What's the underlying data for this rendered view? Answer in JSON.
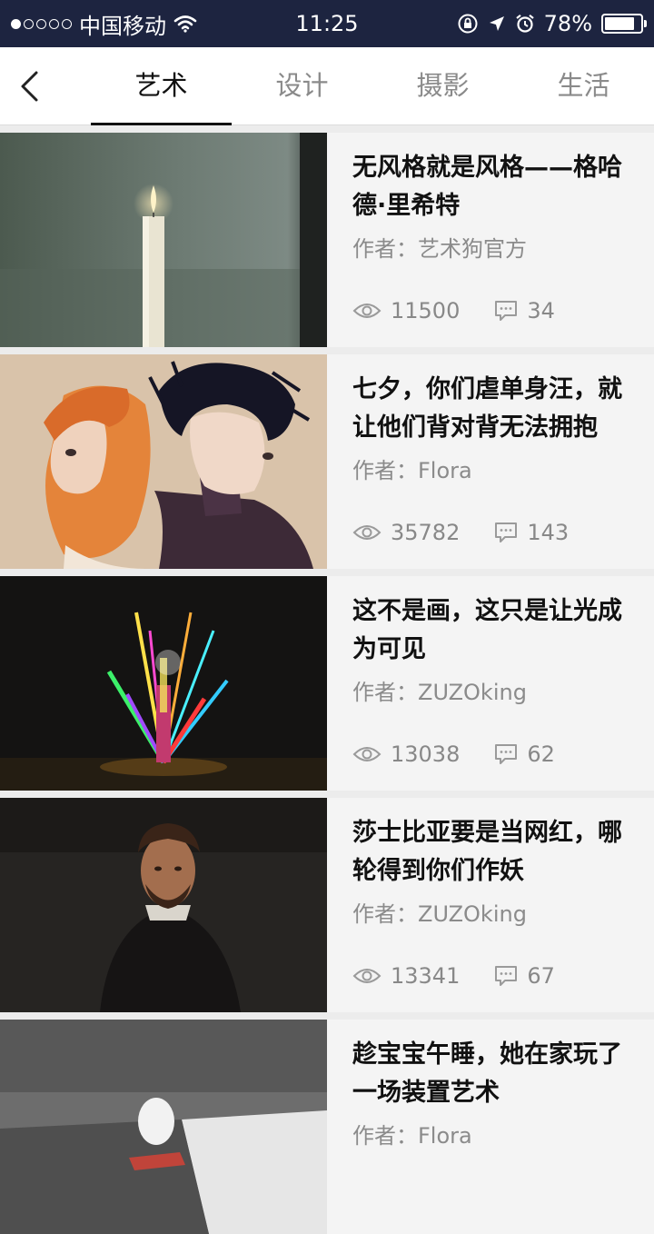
{
  "status_bar": {
    "carrier": "中国移动",
    "time": "11:25",
    "battery": "78%"
  },
  "nav": {
    "tabs": [
      {
        "label": "艺术",
        "active": true
      },
      {
        "label": "设计",
        "active": false
      },
      {
        "label": "摄影",
        "active": false
      },
      {
        "label": "生活",
        "active": false
      }
    ]
  },
  "author_prefix": "作者：",
  "articles": [
    {
      "title": "无风格就是风格——格哈德·里希特",
      "author": "艺术狗官方",
      "views": "11500",
      "comments": "34",
      "image": "candle-painting"
    },
    {
      "title": "七夕，你们虐单身汪，就让他们背对背无法拥抱",
      "author": "Flora",
      "views": "35782",
      "comments": "143",
      "image": "back-to-back-illustration"
    },
    {
      "title": "这不是画，这只是让光成为可见",
      "author": "ZUZOking",
      "views": "13038",
      "comments": "62",
      "image": "prism-light-sculpture"
    },
    {
      "title": "莎士比亚要是当网红，哪轮得到你们作妖",
      "author": "ZUZOking",
      "views": "13341",
      "comments": "67",
      "image": "shakespeare-portrait"
    },
    {
      "title": "趁宝宝午睡，她在家玩了一场装置艺术",
      "author": "Flora",
      "views": "",
      "comments": "",
      "image": "egg-installation"
    }
  ]
}
